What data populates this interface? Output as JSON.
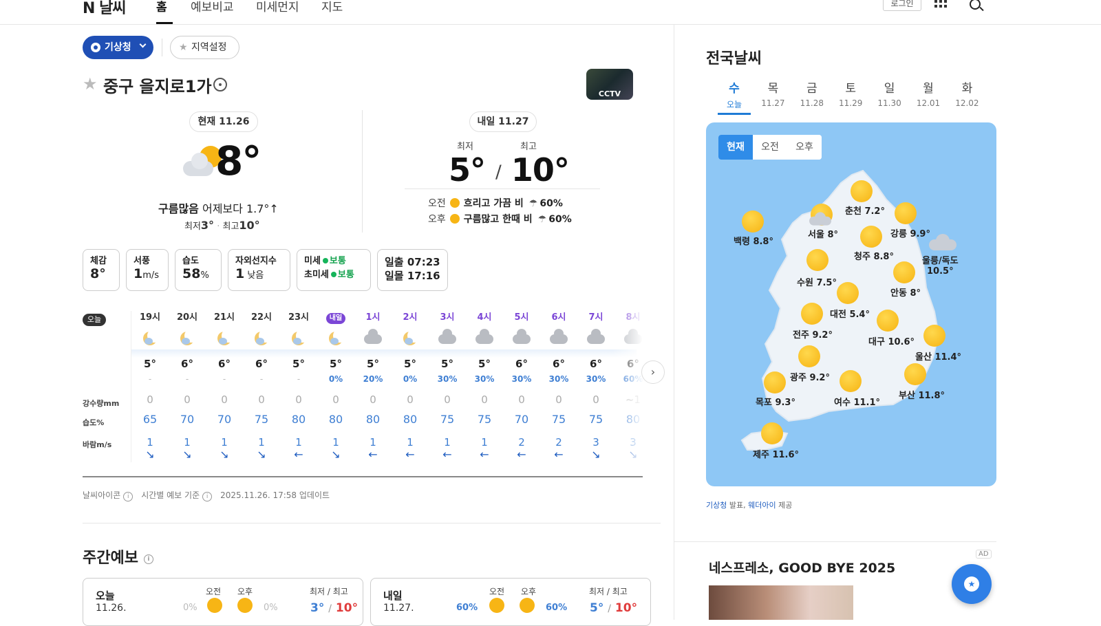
{
  "header": {
    "logo": "N 날씨",
    "nav": [
      "홈",
      "예보비교",
      "미세먼지",
      "지도"
    ],
    "login": "로그인"
  },
  "source_chip": "기상청",
  "region_chip": "지역설정",
  "location": "중구 을지로1가",
  "cctv": "CCTV",
  "current": {
    "date_pill": "현재 11.26",
    "temp": "8°",
    "condition": "구름많음",
    "compare": "어제보다 1.7°↑",
    "min_label": "최저",
    "min": "3°",
    "max_label": "최고",
    "max": "10°"
  },
  "tomorrow": {
    "date_pill": "내일 11.27",
    "min_label": "최저",
    "max_label": "최고",
    "min": "5°",
    "max": "10°",
    "am_label": "오전",
    "am_desc": "흐리고 가끔 비",
    "am_rain": "60%",
    "pm_label": "오후",
    "pm_desc": "구름많고 한때 비",
    "pm_rain": "60%"
  },
  "details": {
    "feels_label": "체감",
    "feels": "8°",
    "wind_label": "서풍",
    "wind": "1",
    "wind_unit": "m/s",
    "humidity_label": "습도",
    "humidity": "58",
    "humidity_unit": "%",
    "uv_label": "자외선지수",
    "uv": "1",
    "uv_level": "낮음",
    "dust_label": "미세",
    "dust": "보통",
    "fdust_label": "초미세",
    "fdust": "보통",
    "sunrise": "일출 07:23",
    "sunset": "일몰 17:16"
  },
  "hourly": {
    "today_badge": "오늘",
    "row_labels": [
      "강수량mm",
      "습도%",
      "바람m/s"
    ],
    "hours": [
      {
        "time": "19시",
        "icon": "moon",
        "temp": "5°",
        "pop": "-",
        "rain": "0",
        "hum": "65",
        "wind": "1",
        "dir": "↘"
      },
      {
        "time": "20시",
        "icon": "moon",
        "temp": "6°",
        "pop": "-",
        "rain": "0",
        "hum": "70",
        "wind": "1",
        "dir": "↘"
      },
      {
        "time": "21시",
        "icon": "moon",
        "temp": "6°",
        "pop": "-",
        "rain": "0",
        "hum": "70",
        "wind": "1",
        "dir": "↘"
      },
      {
        "time": "22시",
        "icon": "moon",
        "temp": "6°",
        "pop": "-",
        "rain": "0",
        "hum": "75",
        "wind": "1",
        "dir": "↘"
      },
      {
        "time": "23시",
        "icon": "moon",
        "temp": "5°",
        "pop": "-",
        "rain": "0",
        "hum": "80",
        "wind": "1",
        "dir": "←"
      },
      {
        "time": "내일",
        "icon": "moon",
        "temp": "5°",
        "pop": "0%",
        "rain": "0",
        "hum": "80",
        "wind": "1",
        "dir": "↘"
      },
      {
        "time": "1시",
        "icon": "cloud",
        "temp": "5°",
        "pop": "20%",
        "rain": "0",
        "hum": "80",
        "wind": "1",
        "dir": "←"
      },
      {
        "time": "2시",
        "icon": "moon",
        "temp": "5°",
        "pop": "0%",
        "rain": "0",
        "hum": "80",
        "wind": "1",
        "dir": "←"
      },
      {
        "time": "3시",
        "icon": "cloud",
        "temp": "5°",
        "pop": "30%",
        "rain": "0",
        "hum": "75",
        "wind": "1",
        "dir": "←"
      },
      {
        "time": "4시",
        "icon": "cloud",
        "temp": "5°",
        "pop": "30%",
        "rain": "0",
        "hum": "75",
        "wind": "1",
        "dir": "←"
      },
      {
        "time": "5시",
        "icon": "cloud",
        "temp": "6°",
        "pop": "30%",
        "rain": "0",
        "hum": "70",
        "wind": "2",
        "dir": "←"
      },
      {
        "time": "6시",
        "icon": "cloud",
        "temp": "6°",
        "pop": "30%",
        "rain": "0",
        "hum": "75",
        "wind": "2",
        "dir": "←"
      },
      {
        "time": "7시",
        "icon": "cloud",
        "temp": "6°",
        "pop": "30%",
        "rain": "0",
        "hum": "75",
        "wind": "3",
        "dir": "↘"
      },
      {
        "time": "8시",
        "icon": "cloud",
        "temp": "6°",
        "pop": "60%",
        "rain": "~1",
        "hum": "80",
        "wind": "3",
        "dir": "↘"
      }
    ]
  },
  "footnote": {
    "icon_label": "날씨아이콘",
    "basis_label": "시간별 예보 기준",
    "updated": "2025.11.26. 17:58 업데이트"
  },
  "weekly": {
    "title": "주간예보",
    "cards": [
      {
        "day": "오늘",
        "date": "11.26.",
        "am": "오전",
        "pm": "오후",
        "am_pop": "0%",
        "pm_pop": "0%",
        "mm_label": "최저 / 최고",
        "min": "3°",
        "max": "10°"
      },
      {
        "day": "내일",
        "date": "11.27.",
        "am": "오전",
        "pm": "오후",
        "am_pop": "60%",
        "pm_pop": "60%",
        "mm_label": "최저 / 최고",
        "min": "5°",
        "max": "10°"
      }
    ]
  },
  "national": {
    "title": "전국날씨",
    "days": [
      {
        "d": "수",
        "dt": "오늘"
      },
      {
        "d": "목",
        "dt": "11.27"
      },
      {
        "d": "금",
        "dt": "11.28"
      },
      {
        "d": "토",
        "dt": "11.29"
      },
      {
        "d": "일",
        "dt": "11.30"
      },
      {
        "d": "월",
        "dt": "12.01"
      },
      {
        "d": "화",
        "dt": "12.02"
      }
    ],
    "segments": [
      "현재",
      "오전",
      "오후"
    ],
    "cities": [
      {
        "name": "춘천",
        "temp": "7.2°",
        "icon": "sun"
      },
      {
        "name": "백령",
        "temp": "8.8°",
        "icon": "sun"
      },
      {
        "name": "강릉",
        "temp": "9.9°",
        "icon": "sun"
      },
      {
        "name": "서울",
        "temp": "8°",
        "icon": "partly"
      },
      {
        "name": "청주",
        "temp": "8.8°",
        "icon": "sun"
      },
      {
        "name": "울릉/독도",
        "temp": "10.5°",
        "icon": "cloud"
      },
      {
        "name": "수원",
        "temp": "7.5°",
        "icon": "sun"
      },
      {
        "name": "안동",
        "temp": "8°",
        "icon": "sun"
      },
      {
        "name": "대전",
        "temp": "5.4°",
        "icon": "sun"
      },
      {
        "name": "전주",
        "temp": "9.2°",
        "icon": "sun"
      },
      {
        "name": "대구",
        "temp": "10.6°",
        "icon": "sun"
      },
      {
        "name": "울산",
        "temp": "11.4°",
        "icon": "sun"
      },
      {
        "name": "광주",
        "temp": "9.2°",
        "icon": "sun"
      },
      {
        "name": "목포",
        "temp": "9.3°",
        "icon": "sun"
      },
      {
        "name": "여수",
        "temp": "11.1°",
        "icon": "sun"
      },
      {
        "name": "부산",
        "temp": "11.8°",
        "icon": "sun"
      },
      {
        "name": "제주",
        "temp": "11.6°",
        "icon": "sun"
      }
    ],
    "source_a": "기상청",
    "source_a_suffix": " 발표, ",
    "source_b": "웨더아이",
    "source_b_suffix": " 제공"
  },
  "ad": {
    "badge": "AD",
    "title": "네스프레소, GOOD BYE 2025"
  }
}
